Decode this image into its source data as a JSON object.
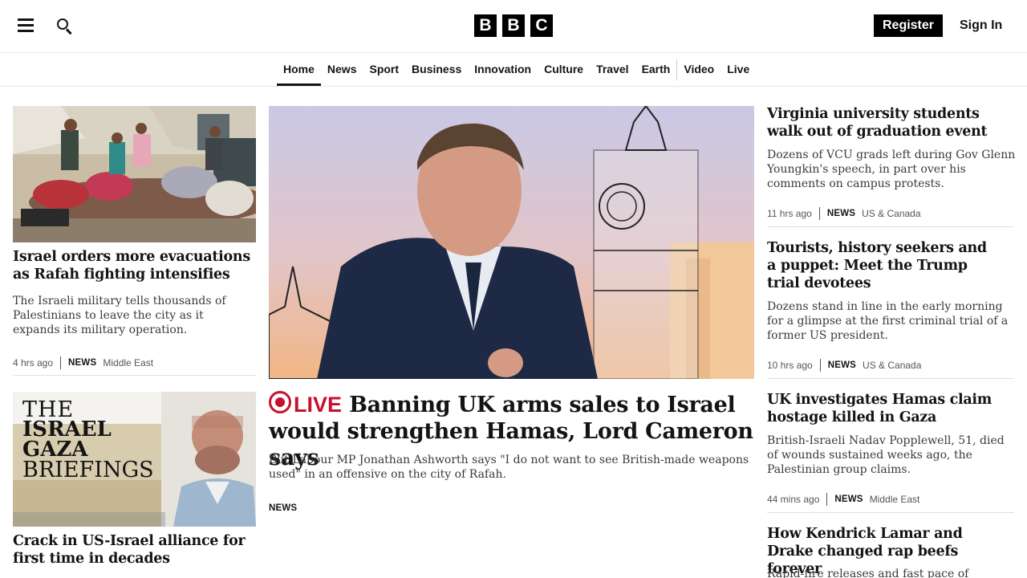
{
  "header": {
    "logo_letters": [
      "B",
      "B",
      "C"
    ],
    "register_label": "Register",
    "signin_label": "Sign In"
  },
  "nav": {
    "items": [
      {
        "label": "Home",
        "active": true
      },
      {
        "label": "News"
      },
      {
        "label": "Sport"
      },
      {
        "label": "Business"
      },
      {
        "label": "Innovation"
      },
      {
        "label": "Culture"
      },
      {
        "label": "Travel"
      },
      {
        "label": "Earth"
      },
      {
        "label": "Video"
      },
      {
        "label": "Live"
      }
    ]
  },
  "left": {
    "story1": {
      "headline": "Israel orders more evacuations as Rafah fighting intensifies",
      "summary": "The Israeli military tells thousands of Palestinians to leave the city as it expands its military operation.",
      "time": "4 hrs ago",
      "tag": "NEWS",
      "region": "Middle East"
    },
    "story2": {
      "image_text": [
        "THE",
        "ISRAEL",
        "GAZA",
        "BRIEFINGS"
      ],
      "headline": "Crack in US-Israel alliance for first time in decades"
    }
  },
  "center": {
    "live_label": "LIVE",
    "headline": "Banning UK arms sales to Israel would strengthen Hamas, Lord Cameron says",
    "summary": "But Labour MP Jonathan Ashworth says \"I do not want to see British-made weapons used\" in an offensive on the city of Rafah.",
    "tag": "NEWS"
  },
  "right": {
    "stories": [
      {
        "headline": "Virginia university students walk out of graduation event",
        "summary": "Dozens of VCU grads left during Gov Glenn Youngkin's speech, in part over his comments on campus protests.",
        "time": "11 hrs ago",
        "tag": "NEWS",
        "region": "US & Canada"
      },
      {
        "headline": "Tourists, history seekers and a puppet: Meet the Trump trial devotees",
        "summary": "Dozens stand in line in the early morning for a glimpse at the first criminal trial of a former US president.",
        "time": "10 hrs ago",
        "tag": "NEWS",
        "region": "US & Canada"
      },
      {
        "headline": "UK investigates Hamas claim hostage killed in Gaza",
        "summary": "British-Israeli Nadav Popplewell, 51, died of wounds sustained weeks ago, the Palestinian group claims.",
        "time": "44 mins ago",
        "tag": "NEWS",
        "region": "Middle East"
      },
      {
        "headline": "How Kendrick Lamar and Drake changed rap beefs forever",
        "summary": "Rapid-fire releases and fast pace of modern"
      }
    ]
  },
  "colors": {
    "live_red": "#c8102e",
    "text": "#141414",
    "meta": "#545658"
  }
}
